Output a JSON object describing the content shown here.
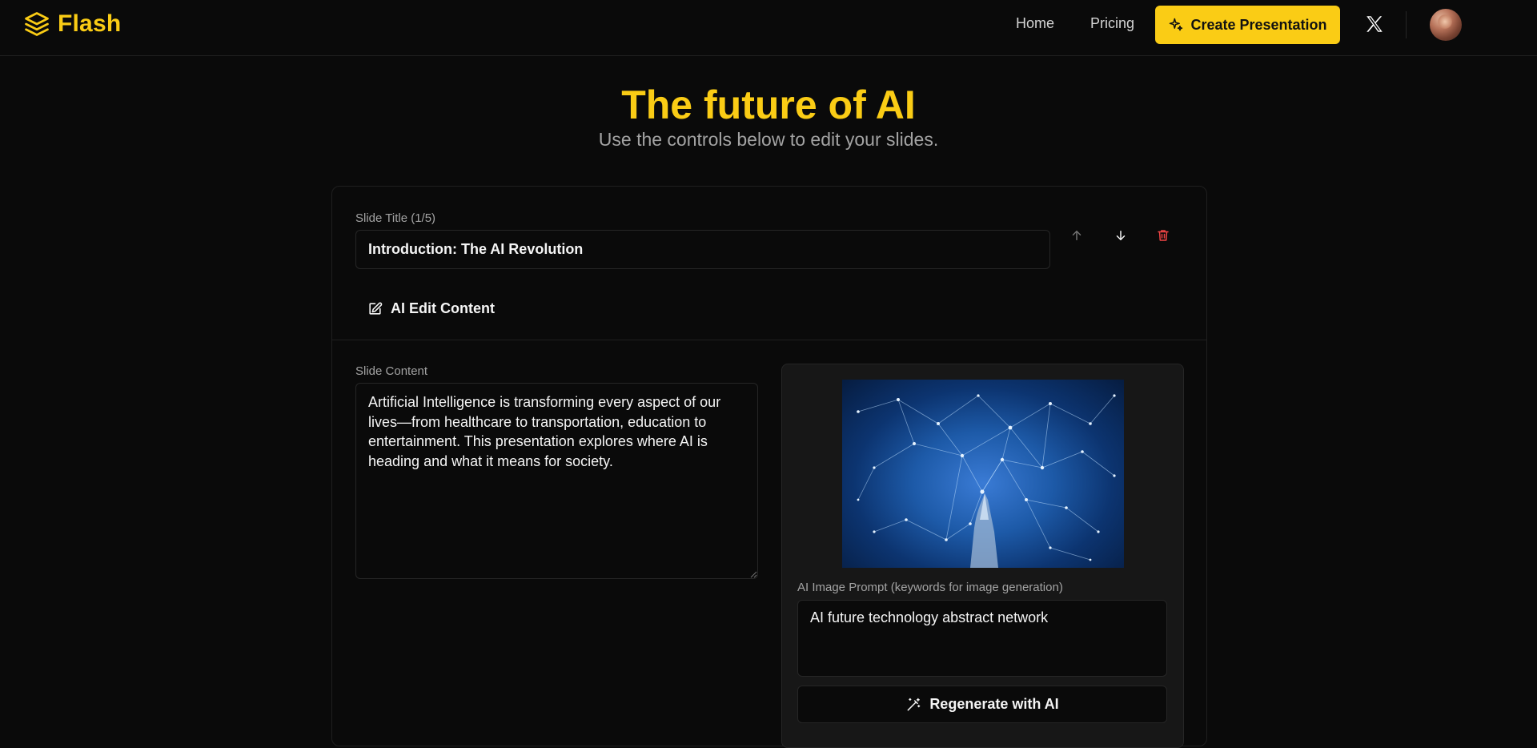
{
  "header": {
    "brand": "Flash",
    "nav": {
      "home": "Home",
      "pricing": "Pricing"
    },
    "cta_label": "Create Presentation",
    "accent_color": "#facc15"
  },
  "page": {
    "title": "The future of AI",
    "subtitle": "Use the controls below to edit your slides."
  },
  "slide": {
    "title_label": "Slide Title (1/5)",
    "title_value": "Introduction: The AI Revolution",
    "ai_edit_label": "AI Edit Content",
    "content_label": "Slide Content",
    "content_value": "Artificial Intelligence is transforming every aspect of our lives—from healthcare to transportation, education to entertainment. This presentation explores where AI is heading and what it means for society.",
    "image_prompt_label": "AI Image Prompt (keywords for image generation)",
    "image_prompt_value": "AI future technology abstract network",
    "regenerate_label": "Regenerate with AI"
  },
  "icons": {
    "logo": "layers-icon",
    "cta": "sparkles-icon",
    "social": "x-logo-icon",
    "move_up": "arrow-up-icon",
    "move_down": "arrow-down-icon",
    "delete": "trash-icon",
    "edit": "pencil-square-icon",
    "regenerate": "magic-wand-icon"
  }
}
